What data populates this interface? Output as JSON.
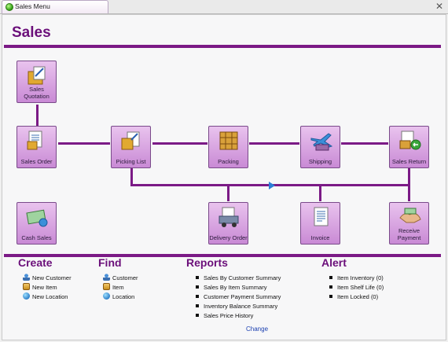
{
  "tab": {
    "label": "Sales Menu"
  },
  "page": {
    "title": "Sales"
  },
  "nodes": {
    "sales_quotation": "Sales\nQuotation",
    "sales_order": "Sales Order",
    "picking_list": "Picking List",
    "packing": "Packing",
    "shipping": "Shipping",
    "sales_return": "Sales Return",
    "cash_sales": "Cash Sales",
    "delivery_order": "Delivery Order",
    "invoice": "Invoice",
    "receive_payment": "Receive\nPayment"
  },
  "create": {
    "title": "Create",
    "items": [
      "New Customer",
      "New Item",
      "New Location"
    ]
  },
  "find": {
    "title": "Find",
    "items": [
      "Customer",
      "Item",
      "Location"
    ]
  },
  "reports": {
    "title": "Reports",
    "items": [
      "Sales By Customer Summary",
      "Sales By Item Summary",
      "Customer Payment Summary",
      "Inventory Balance Summary",
      "Sales Price History"
    ]
  },
  "alert": {
    "title": "Alert",
    "items": [
      "Item Inventory (0)",
      "Item Shelf Life (0)",
      "Item Locked (0)"
    ]
  },
  "change_link": "Change",
  "colors": {
    "accent": "#7b1a86",
    "title": "#6b0f7a",
    "button_top": "#e9c3ee",
    "button_bottom": "#c98ad5",
    "link": "#1a3fb0"
  }
}
